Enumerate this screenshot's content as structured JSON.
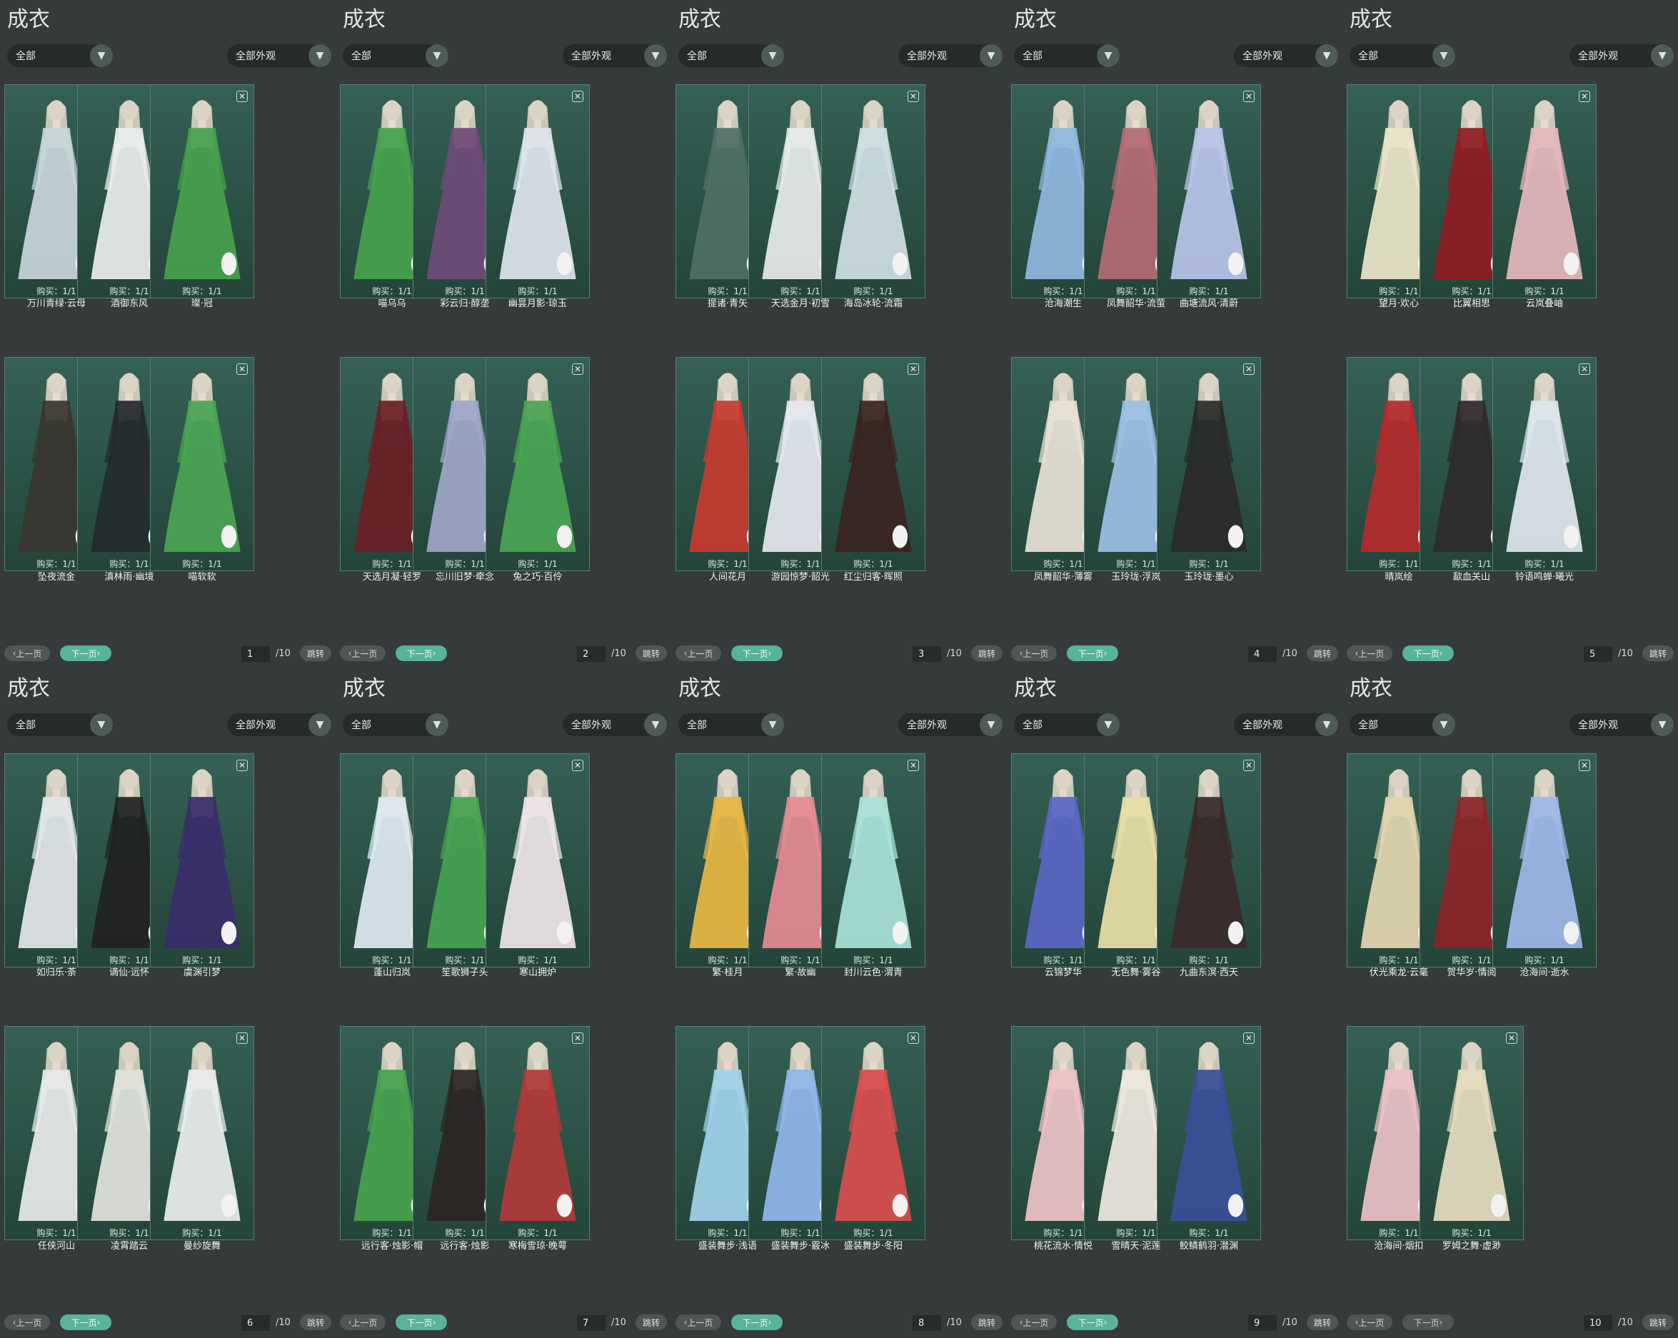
{
  "panel_title": "成衣",
  "filter_category": "全部",
  "filter_look": "全部外观",
  "purchase_label": "购买：1/1",
  "prev_label": "上一页",
  "next_label": "下一页",
  "jump_label": "跳转",
  "total_pages": "/10",
  "colors": {
    "accent": "#58b39b",
    "card_bg": "#2f584c",
    "page_bg": "#34393a"
  },
  "icons": {
    "trash": "trash-icon",
    "dropdown": "chevron-down-icon"
  },
  "pages": [
    {
      "page": "1",
      "next_enabled": true,
      "items": [
        {
          "name": "万川青绿·云母",
          "color": "#c9d6da"
        },
        {
          "name": "酒御东风",
          "color": "#eceeed"
        },
        {
          "name": "璨·冠",
          "color": "#46a24c"
        },
        {
          "name": "坠夜流金",
          "color": "#3a3531"
        },
        {
          "name": "滇林雨·幽境",
          "color": "#242a2e"
        },
        {
          "name": "喵软软",
          "color": "#4aa553"
        }
      ]
    },
    {
      "page": "2",
      "next_enabled": true,
      "items": [
        {
          "name": "喵乌乌",
          "color": "#45a34d"
        },
        {
          "name": "彩云归·醇垄",
          "color": "#6e4b7a"
        },
        {
          "name": "幽昙月影·琼玉",
          "color": "#dfe5ee"
        },
        {
          "name": "天选月凝·轻罗",
          "color": "#6a1f24"
        },
        {
          "name": "忘川旧梦·牵念",
          "color": "#9fa7c9"
        },
        {
          "name": "兔之巧·百伶",
          "color": "#49a552"
        }
      ]
    },
    {
      "page": "3",
      "next_enabled": true,
      "items": [
        {
          "name": "提诸·青矢",
          "color": "#4f6f66"
        },
        {
          "name": "天选金月·初雪",
          "color": "#e7ebea"
        },
        {
          "name": "海岛冰轮·流霜",
          "color": "#cfe0e4"
        },
        {
          "name": "人间花月",
          "color": "#c63b2f"
        },
        {
          "name": "游园惊梦·韶光",
          "color": "#e6e9f0"
        },
        {
          "name": "红尘归客·晖照",
          "color": "#3a2420"
        }
      ]
    },
    {
      "page": "4",
      "next_enabled": true,
      "items": [
        {
          "name": "沧海潮生",
          "color": "#8fb9df"
        },
        {
          "name": "凤舞韶华·流萤",
          "color": "#b56b73"
        },
        {
          "name": "曲塘流风·清蔚",
          "color": "#b9c4ea"
        },
        {
          "name": "凤舞韶华·薄雾",
          "color": "#e9e3d6"
        },
        {
          "name": "玉玲珑·浮岚",
          "color": "#9cc0e6"
        },
        {
          "name": "玉玲珑·墨心",
          "color": "#2a2a2a"
        }
      ]
    },
    {
      "page": "5",
      "next_enabled": true,
      "items": [
        {
          "name": "望月·欢心",
          "color": "#ece6c9"
        },
        {
          "name": "比翼相思",
          "color": "#8f1c22"
        },
        {
          "name": "云岚叠岫",
          "color": "#e7b8bd"
        },
        {
          "name": "晴岚绘",
          "color": "#b52a2c"
        },
        {
          "name": "歃血关山",
          "color": "#302a2b"
        },
        {
          "name": "铃语鸣蝉·曦光",
          "color": "#dfe7ee"
        }
      ]
    },
    {
      "page": "6",
      "next_enabled": true,
      "items": [
        {
          "name": "如归乐·荼",
          "color": "#e4e7e9"
        },
        {
          "name": "谪仙·远怀",
          "color": "#222222"
        },
        {
          "name": "虞渊引梦",
          "color": "#3a2d6a"
        },
        {
          "name": "任侠河山",
          "color": "#e8eaeb"
        },
        {
          "name": "凌霄踏云",
          "color": "#e3e3dd"
        },
        {
          "name": "曼纱旋舞",
          "color": "#eceeef"
        }
      ]
    },
    {
      "page": "7",
      "next_enabled": true,
      "items": [
        {
          "name": "蓬山归岚",
          "color": "#dfe9f2"
        },
        {
          "name": "笙歌狮子头",
          "color": "#47a44f"
        },
        {
          "name": "寒山拥炉",
          "color": "#efe5ea"
        },
        {
          "name": "远行客·烛影·帽",
          "color": "#46a34e"
        },
        {
          "name": "远行客·烛影",
          "color": "#2b2524"
        },
        {
          "name": "寒梅雪琼·晚萼",
          "color": "#b23a3a"
        }
      ]
    },
    {
      "page": "8",
      "next_enabled": true,
      "items": [
        {
          "name": "繁·桂月",
          "color": "#e8b744"
        },
        {
          "name": "繁·故幽",
          "color": "#e78a93"
        },
        {
          "name": "封川云色·渭青",
          "color": "#a9e3d9"
        },
        {
          "name": "盛装舞步·浅语",
          "color": "#9fd2ec"
        },
        {
          "name": "盛装舞步·霰冰",
          "color": "#8fb7ea"
        },
        {
          "name": "盛装舞步·冬阳",
          "color": "#d94d4d"
        }
      ]
    },
    {
      "page": "9",
      "next_enabled": true,
      "items": [
        {
          "name": "云锦梦华",
          "color": "#5b66c7"
        },
        {
          "name": "无色舞·雾谷",
          "color": "#e8dfa8"
        },
        {
          "name": "九曲东溟·西天",
          "color": "#3a2a2a"
        },
        {
          "name": "桃花流水·情悦",
          "color": "#efc3c8"
        },
        {
          "name": "雪晴天·泥莲",
          "color": "#efe9df"
        },
        {
          "name": "鲛鳞鹤羽·潜渊",
          "color": "#3a4f98"
        }
      ]
    },
    {
      "page": "10",
      "next_enabled": false,
      "items": [
        {
          "name": "伏光乘龙·云毫",
          "color": "#e3d6b0"
        },
        {
          "name": "贺华岁·情阅",
          "color": "#8b2428"
        },
        {
          "name": "沧海间·逝水",
          "color": "#9fb8e8"
        },
        {
          "name": "沧海间·烟扣",
          "color": "#ecc1c8"
        },
        {
          "name": "罗姆之舞·虚渺",
          "color": "#e6dcc0"
        }
      ]
    }
  ]
}
